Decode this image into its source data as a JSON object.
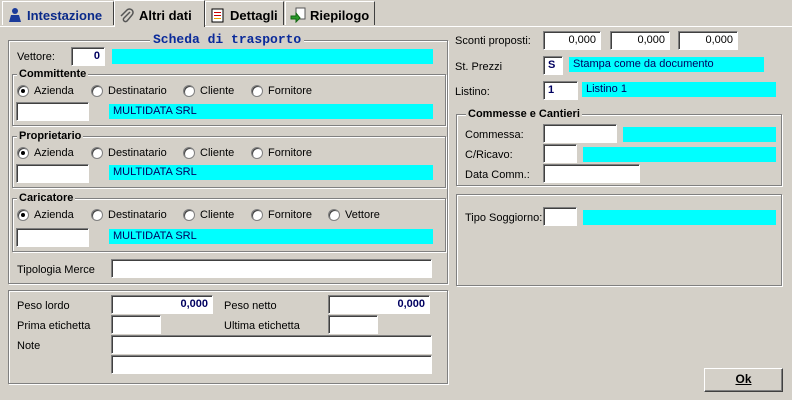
{
  "tabs": [
    {
      "label": "Intestazione",
      "icon": "person-icon"
    },
    {
      "label": "Altri dati",
      "icon": "paperclip-icon"
    },
    {
      "label": "Dettagli",
      "icon": "document-icon"
    },
    {
      "label": "Riepilogo",
      "icon": "summary-icon"
    }
  ],
  "scheda": {
    "title": "Scheda di trasporto",
    "vettore_label": "Vettore:",
    "vettore_code": "0",
    "vettore_name": ""
  },
  "committente": {
    "title": "Committente",
    "options": [
      "Azienda",
      "Destinatario",
      "Cliente",
      "Fornitore"
    ],
    "selected": "Azienda",
    "code": "",
    "name": "MULTIDATA SRL"
  },
  "proprietario": {
    "title": "Proprietario",
    "options": [
      "Azienda",
      "Destinatario",
      "Cliente",
      "Fornitore"
    ],
    "selected": "Azienda",
    "code": "",
    "name": "MULTIDATA SRL"
  },
  "caricatore": {
    "title": "Caricatore",
    "options": [
      "Azienda",
      "Destinatario",
      "Cliente",
      "Fornitore",
      "Vettore"
    ],
    "selected": "Azienda",
    "code": "",
    "name": "MULTIDATA SRL"
  },
  "tipologia_merce": {
    "label": "Tipologia Merce",
    "value": ""
  },
  "pesi": {
    "peso_lordo_label": "Peso lordo",
    "peso_lordo": "0,000",
    "peso_netto_label": "Peso netto",
    "peso_netto": "0,000",
    "prima_etichetta_label": "Prima etichetta",
    "prima_etichetta": "",
    "ultima_etichetta_label": "Ultima etichetta",
    "ultima_etichetta": "",
    "note_label": "Note",
    "note1": "",
    "note2": ""
  },
  "sconti": {
    "label": "Sconti proposti:",
    "values": [
      "0,000",
      "0,000",
      "0,000"
    ]
  },
  "st_prezzi": {
    "label": "St. Prezzi",
    "code": "S",
    "desc": "Stampa come da documento"
  },
  "listino": {
    "label": "Listino:",
    "code": "1",
    "desc": "Listino 1"
  },
  "commesse": {
    "title": "Commesse e Cantieri",
    "commessa_label": "Commessa:",
    "commessa": "",
    "commessa_desc": "",
    "cricavo_label": "C/Ricavo:",
    "cricavo": "",
    "cricavo_desc": "",
    "data_comm_label": "Data Comm.:",
    "data_comm": ""
  },
  "soggiorno": {
    "label": "Tipo Soggiorno:",
    "code": "",
    "desc": ""
  },
  "ok_button": "Ok",
  "colors": {
    "background": "#d4d0c8",
    "lookup": "#00ffff",
    "tab_text": "#0a2a8a"
  }
}
